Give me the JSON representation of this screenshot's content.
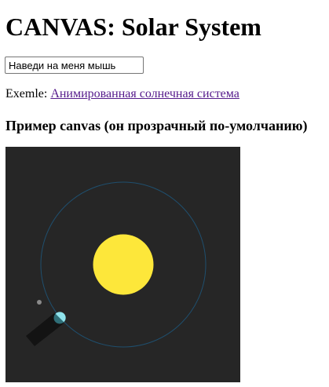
{
  "page": {
    "title": "CANVAS: Solar System"
  },
  "hover_input": {
    "value": "Наведи на меня мышь"
  },
  "example": {
    "prefix": "Exemle: ",
    "link_text": "Анимированная солнечная система"
  },
  "section": {
    "heading": "Пример canvas (он прозрачный по-умолчанию)"
  },
  "canvas": {
    "colors": {
      "background": "#262626",
      "orbit": "#1f4f6e",
      "sun": "#fde73a",
      "earth": "#8fe3ec",
      "earth_night": "#2f6f78",
      "shadow": "#131313",
      "moon": "#8a8a8a"
    }
  }
}
